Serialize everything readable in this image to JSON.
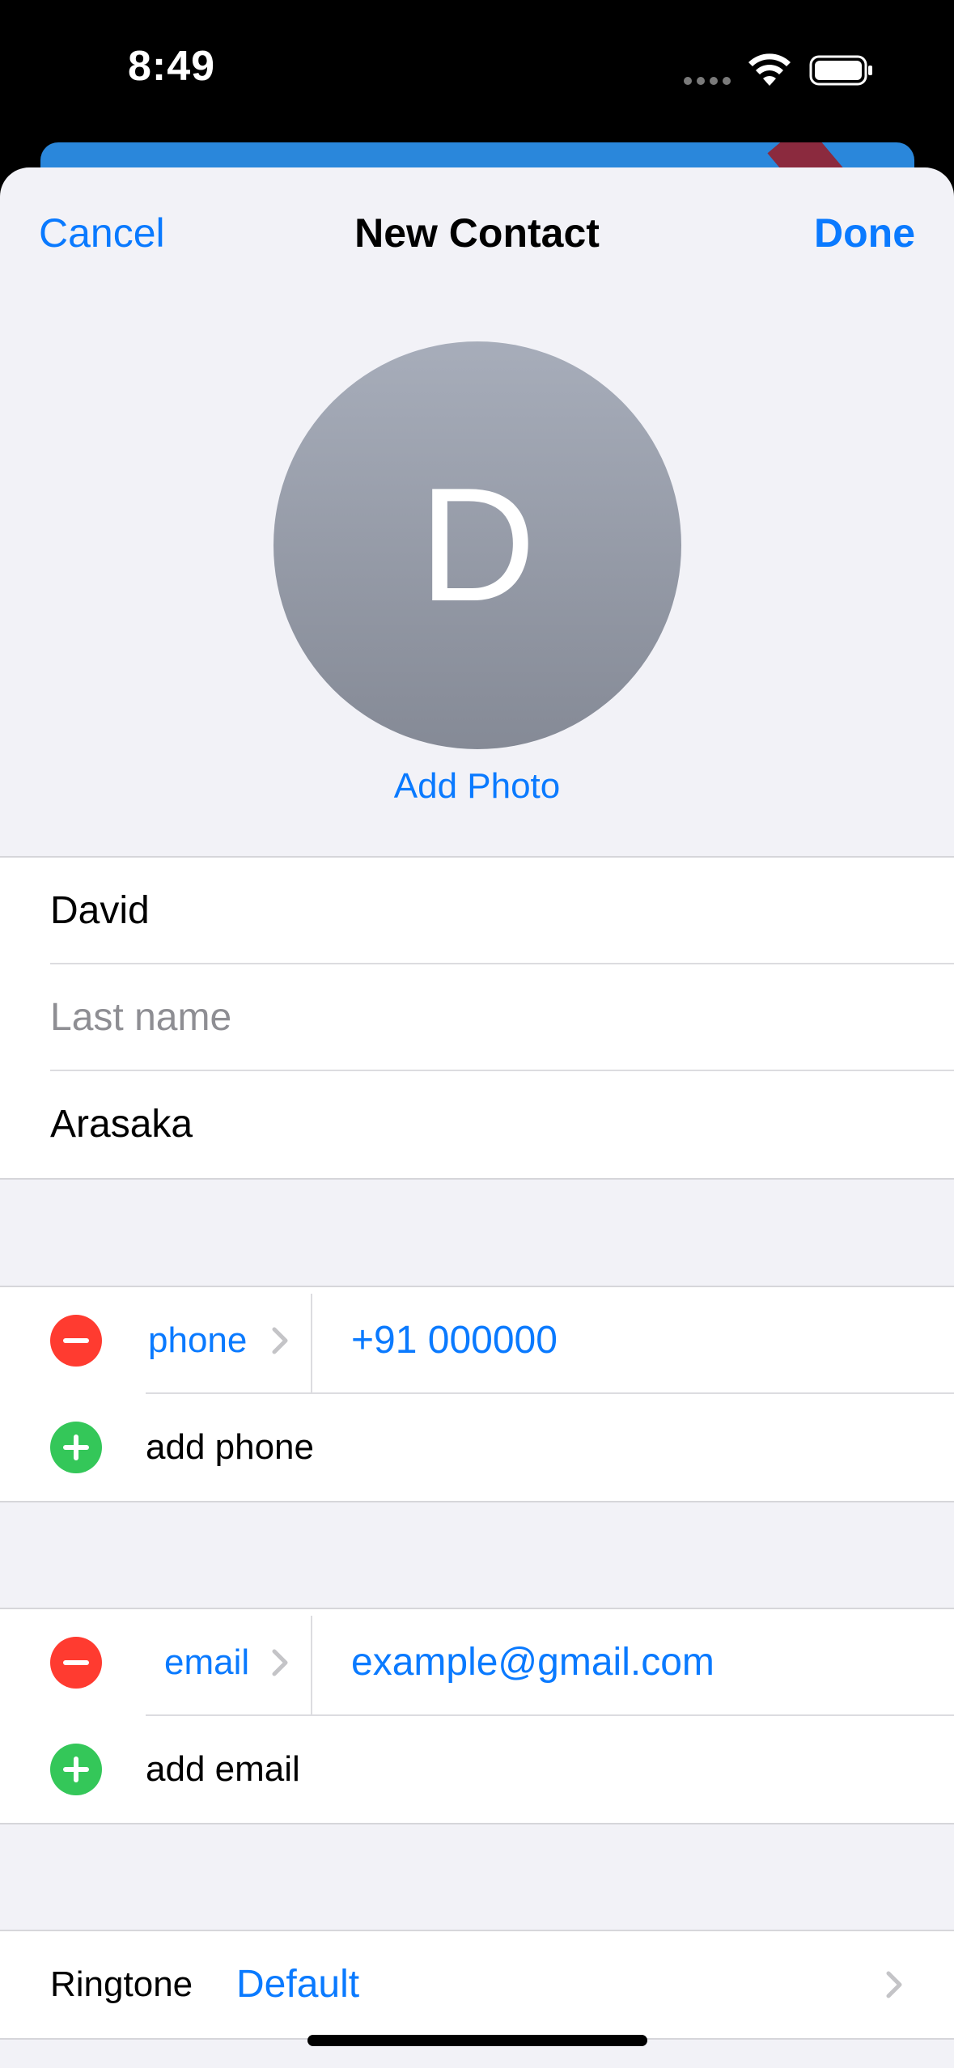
{
  "status": {
    "time": "8:49"
  },
  "nav": {
    "cancel": "Cancel",
    "title": "New Contact",
    "done": "Done"
  },
  "avatar": {
    "initial": "D",
    "add_photo": "Add Photo"
  },
  "name_fields": {
    "first_name": "David",
    "last_name_placeholder": "Last name",
    "company": "Arasaka"
  },
  "phone": {
    "label": "phone",
    "value": "+91 000000",
    "add": "add phone"
  },
  "email": {
    "label": "email",
    "value": "example@gmail.com",
    "add": "add email"
  },
  "ringtone": {
    "label": "Ringtone",
    "value": "Default"
  },
  "colors": {
    "accent": "#0A7AFF",
    "remove": "#FF3B30",
    "add": "#34C759",
    "background": "#F2F2F7"
  },
  "icons": [
    "wifi-icon",
    "battery-icon",
    "remove-circle-icon",
    "add-circle-icon",
    "chevron-right-icon"
  ]
}
